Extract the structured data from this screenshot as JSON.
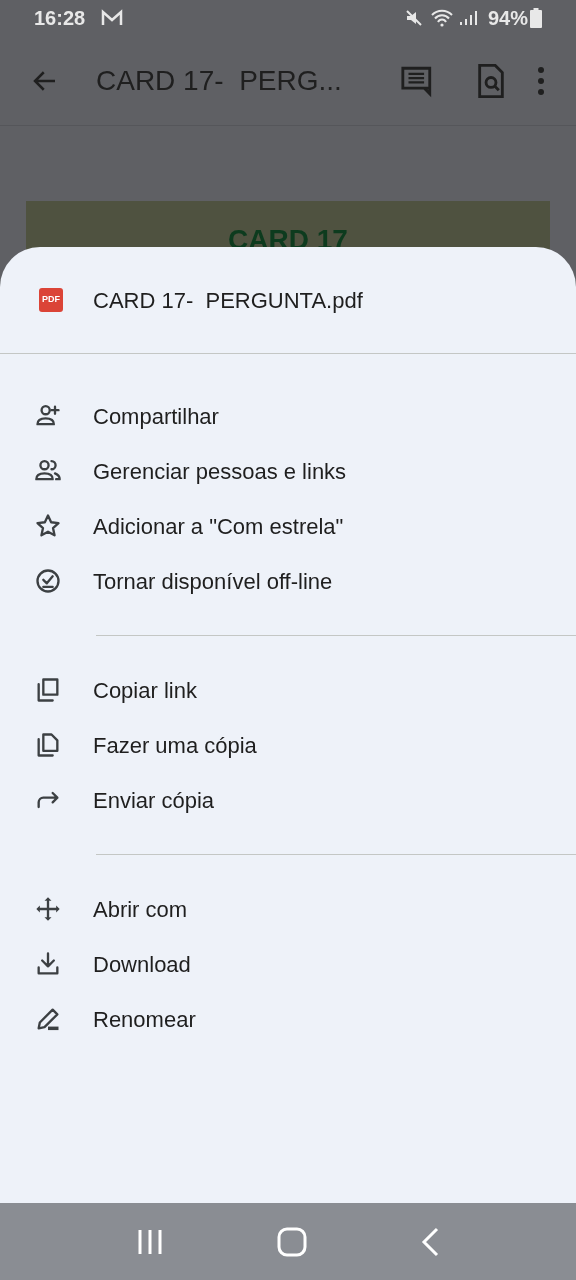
{
  "status_bar": {
    "time": "16:28",
    "battery": "94%"
  },
  "app_bar": {
    "title": "CARD 17-  PERG..."
  },
  "document": {
    "heading": "CARD 17"
  },
  "sheet": {
    "file_name": "CARD 17-  PERGUNTA.pdf",
    "file_badge": "PDF",
    "sections": [
      [
        {
          "label": "Compartilhar"
        },
        {
          "label": "Gerenciar pessoas e links"
        },
        {
          "label": "Adicionar a \"Com estrela\""
        },
        {
          "label": "Tornar disponível off-line"
        }
      ],
      [
        {
          "label": "Copiar link"
        },
        {
          "label": "Fazer uma cópia"
        },
        {
          "label": "Enviar cópia"
        }
      ],
      [
        {
          "label": "Abrir com"
        },
        {
          "label": "Download"
        },
        {
          "label": "Renomear"
        }
      ]
    ]
  }
}
